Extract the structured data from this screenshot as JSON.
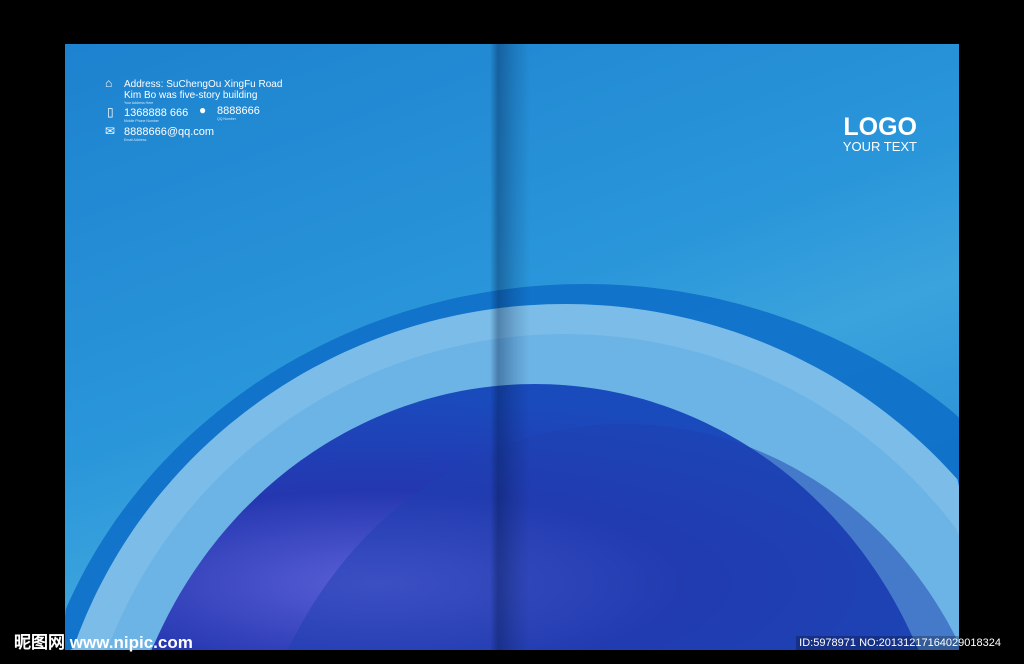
{
  "contact": {
    "address_line1": "Address: SuChengOu XingFu Road",
    "address_line2": "Kim Bo was five-story building",
    "address_caption": "Your Address Here",
    "phone": "1368888 666",
    "phone_caption": "Mobile Phone Number",
    "qq": "8888666",
    "qq_caption": "QQ Number",
    "email": "8888666@qq.com",
    "email_caption": "Email Address"
  },
  "logo": {
    "title": "LOGO",
    "subtitle": "YOUR TEXT"
  },
  "watermark": {
    "site": "昵图网 www.nipic.com",
    "id": "ID:5978971 NO:20131217164029018324"
  },
  "colors": {
    "background": "#1d82cf",
    "sphere": "#1a2fa8"
  }
}
